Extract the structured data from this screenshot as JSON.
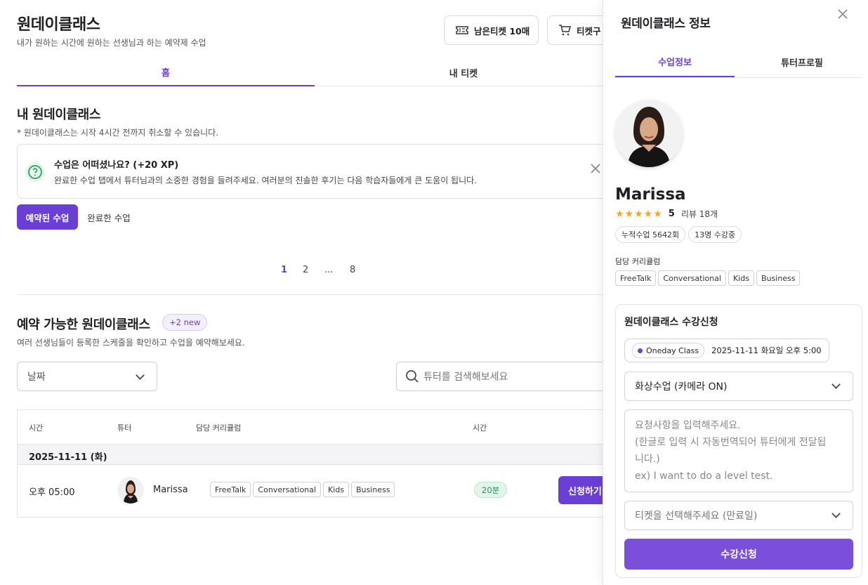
{
  "header": {
    "title": "원데이클래스",
    "subtitle": "내가 원하는 시간에 원하는 선생님과 하는 예약제 수업",
    "tickets_button": "남은티켓 10매",
    "buy_button": "티켓구"
  },
  "tabs": [
    {
      "label": "홈"
    },
    {
      "label": "내 티켓"
    }
  ],
  "my_classes": {
    "title": "내 원데이클래스",
    "note": "* 원데이클래스는 시작 4시간 전까지 취소할 수 있습니다.",
    "review": {
      "title": "수업은 어떠셨나요? (+20 XP)",
      "body": "완료한 수업 탭에서 튜터님과의 소중한 경험을 들려주세요. 여러분의 진솔한 후기는 다음 학습자들에게 큰 도움이 됩니다."
    },
    "filters": [
      "예약된 수업",
      "완료한 수업"
    ],
    "pagination": [
      "1",
      "2",
      "...",
      "8"
    ]
  },
  "available": {
    "title": "예약 가능한 원데이클래스",
    "new_badge": "+2 new",
    "note": "여러 선생님들이 등록한 스케줄을 확인하고 수업을 예약해보세요.",
    "date_select": "날짜",
    "search_placeholder": "튜터를 검색해보세요",
    "columns": [
      "시간",
      "튜터",
      "담당 커리큘럼",
      "시간"
    ],
    "date_group": "2025-11-11 (화)",
    "row": {
      "time": "오후 05:00",
      "tutor": "Marissa",
      "tags": [
        "FreeTalk",
        "Conversational",
        "Kids",
        "Business"
      ],
      "duration": "20분",
      "action": "신청하기"
    }
  },
  "panel": {
    "title": "원데이클래스 정보",
    "tabs": [
      {
        "label": "수업정보"
      },
      {
        "label": "튜터프로필"
      }
    ],
    "tutor": {
      "name": "Marissa",
      "rating": "5",
      "reviews": "리뷰 18개",
      "stars": 5,
      "badges": [
        "누적수업 5642회",
        "13명 수강중"
      ],
      "curriculum_label": "담당 커리큘럼",
      "curriculum": [
        "FreeTalk",
        "Conversational",
        "Kids",
        "Business"
      ]
    },
    "signup": {
      "title": "원데이클래스 수강신청",
      "class_type": "Oneday Class",
      "datetime": "2025-11-11 화요일 오후 5:00",
      "mode_select": "화상수업 (카메라 ON)",
      "request_placeholder_1": "요청사항을 입력해주세요.",
      "request_placeholder_2": "(한글로 입력 시 자동번역되어 튜터에게 전달됩",
      "request_placeholder_3": "니다.)",
      "request_placeholder_4": "ex) I want to do a level test.",
      "ticket_select": "티켓을 선택해주세요 (만료일)",
      "submit": "수강신청"
    }
  },
  "colors": {
    "accent": "#6b3fd6",
    "submit": "#7b4fd9",
    "star": "#f5a623",
    "duration_green": "#e3f6ea"
  }
}
